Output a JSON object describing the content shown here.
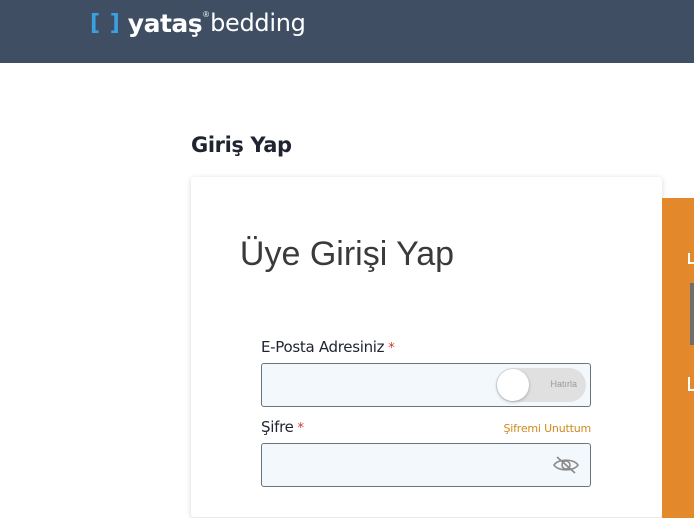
{
  "header": {
    "logo_bracket": "[ ]",
    "logo_brand": "yataş",
    "logo_registered": "®",
    "logo_suffix": "bedding"
  },
  "page": {
    "title": "Giriş Yap"
  },
  "login_card": {
    "heading": "Üye Girişi Yap",
    "email_label": "E-Posta Adresiniz",
    "email_required": "*",
    "email_value": "",
    "remember_label": "Hatırla",
    "password_label": "Şifre",
    "password_required": "*",
    "password_value": "",
    "forgot_password": "Şifremi Unuttum"
  },
  "colors": {
    "header_bg": "#3f4e63",
    "accent_orange": "#e3892c",
    "link": "#d08a1a",
    "required": "#d3372a"
  },
  "icons": {
    "toggle_password_visibility": "eye-slash-icon"
  }
}
